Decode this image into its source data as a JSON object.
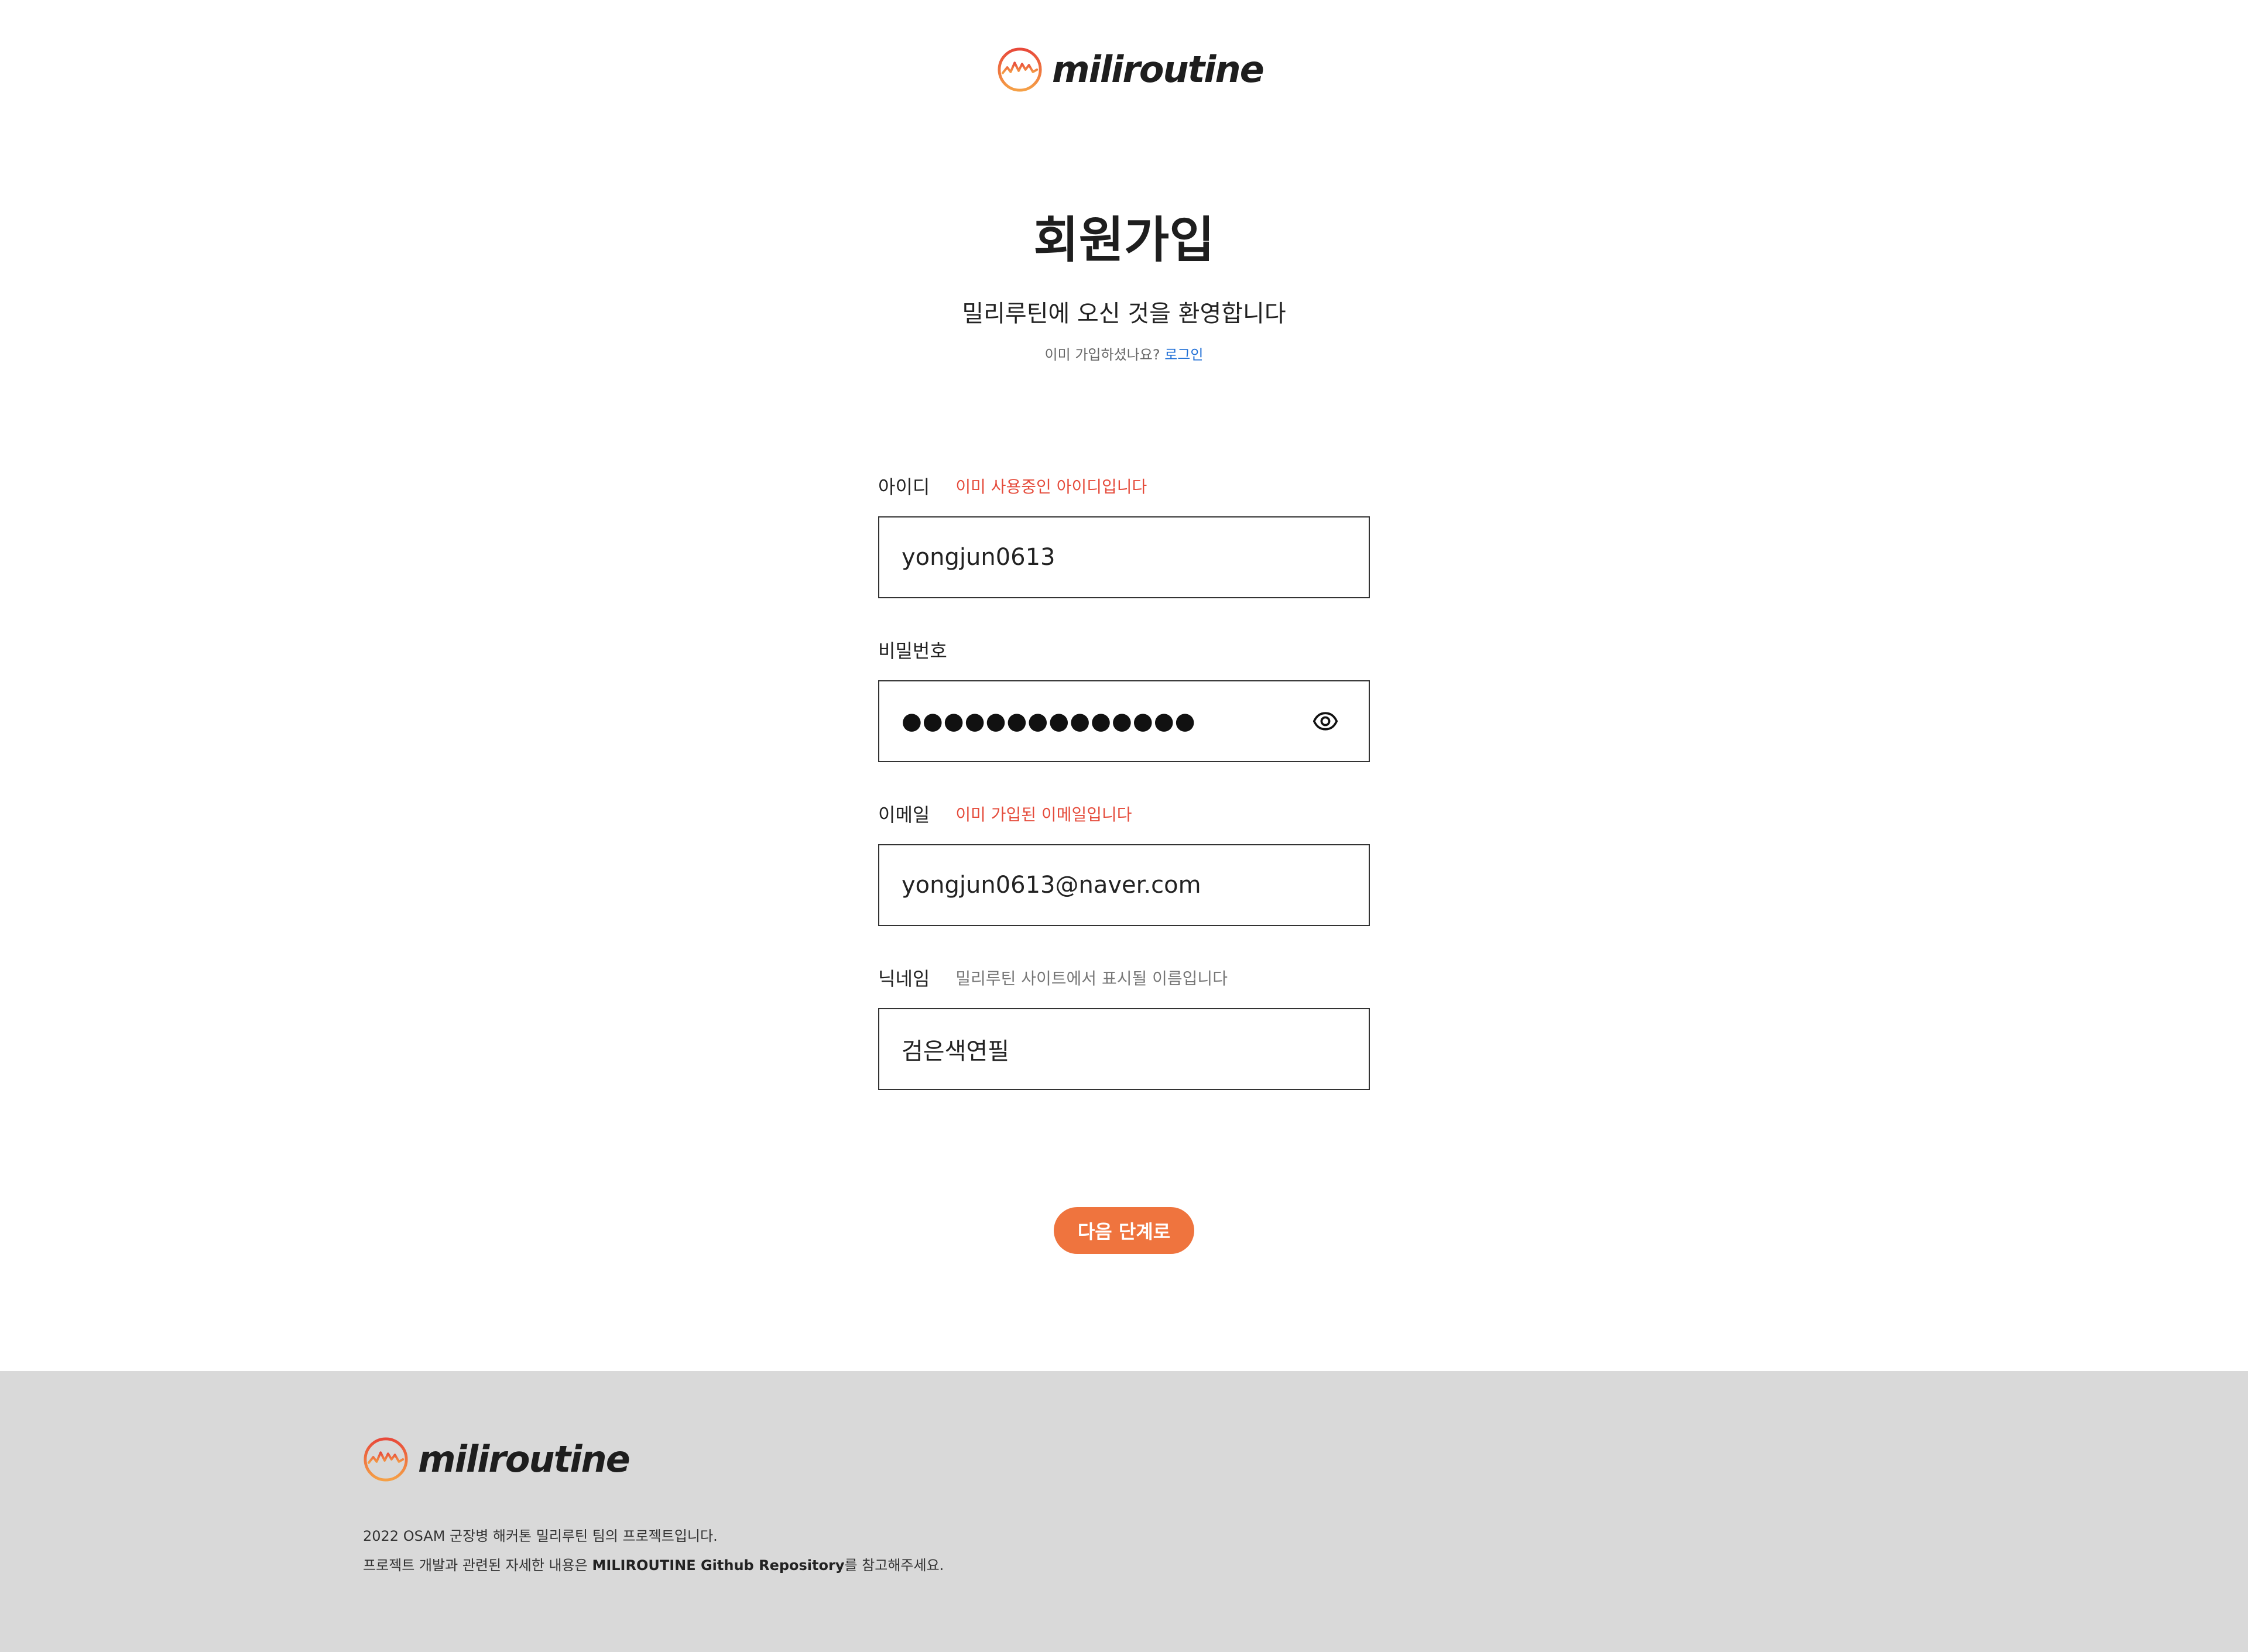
{
  "brand": {
    "name": "miliroutine",
    "accent_color": "#ef743e",
    "logo_icon": "mountain-circle-icon"
  },
  "header": {
    "title": "회원가입",
    "subtitle": "밀리루틴에 오신 것을 환영합니다",
    "already_text": "이미 가입하셨나요?",
    "login_link": "로그인"
  },
  "form": {
    "username": {
      "label": "아이디",
      "hint": "이미 사용중인 아이디입니다",
      "hint_type": "error",
      "value": "yongjun0613"
    },
    "password": {
      "label": "비밀번호",
      "masked_value": "●●●●●●●●●●●●●●",
      "toggle_icon": "eye-icon"
    },
    "email": {
      "label": "이메일",
      "hint": "이미 가입된 이메일입니다",
      "hint_type": "error",
      "value": "yongjun0613@naver.com"
    },
    "nickname": {
      "label": "닉네임",
      "hint": "밀리루틴 사이트에서 표시될 이름입니다",
      "hint_type": "info",
      "value": "검은색연필"
    },
    "submit_label": "다음 단계로"
  },
  "footer": {
    "brand_name": "miliroutine",
    "line1": "2022 OSAM 군장병 해커톤 밀리루틴 팀의 프로젝트입니다.",
    "line2_prefix": "프로젝트 개발과 관련된 자세한 내용은 ",
    "line2_link": "MILIROUTINE Github Repository",
    "line2_suffix": "를 참고해주세요.",
    "background_color": "#d9d9d9"
  }
}
